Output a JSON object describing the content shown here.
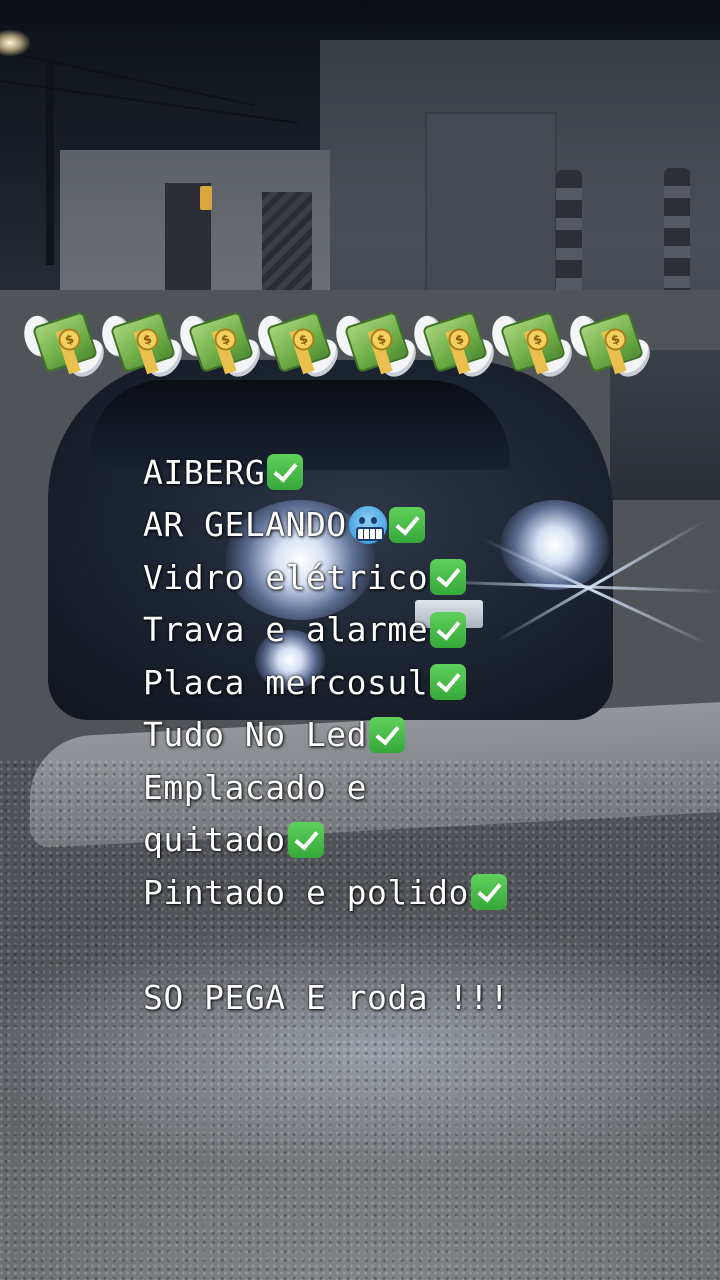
{
  "photo": {
    "subject": "car-at-night",
    "emoji_row": {
      "icon": "money-with-wings-icon",
      "count": 8
    }
  },
  "caption": {
    "lines": [
      {
        "text": "AIBERG",
        "suffix": [
          "check-mark-icon"
        ]
      },
      {
        "text": "AR GELANDO",
        "suffix": [
          "cold-face-icon",
          "check-mark-icon"
        ]
      },
      {
        "text": "Vidro elétrico",
        "suffix": [
          "check-mark-icon"
        ]
      },
      {
        "text": "Trava e alarme",
        "suffix": [
          "check-mark-icon"
        ]
      },
      {
        "text": "Placa mercosul",
        "suffix": [
          "check-mark-icon"
        ]
      },
      {
        "text": "Tudo No Led",
        "suffix": [
          "check-mark-icon"
        ]
      },
      {
        "text": "Emplacado e",
        "suffix": []
      },
      {
        "text": "quitado",
        "suffix": [
          "check-mark-icon"
        ]
      },
      {
        "text": "Pintado e polido",
        "suffix": [
          "check-mark-icon"
        ]
      },
      {
        "text": "SO PEGA E roda !!!",
        "suffix": []
      }
    ]
  },
  "colors": {
    "caption_text": "#ffffff",
    "check_green": "#36a83a",
    "money_green": "#6fae47"
  }
}
